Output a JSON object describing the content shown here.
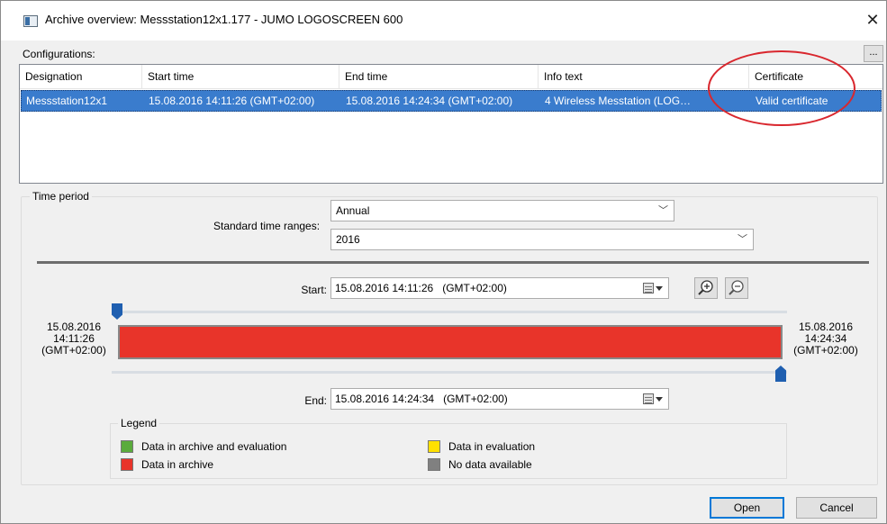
{
  "window": {
    "title": "Archive overview: Messstation12x1.177 - JUMO LOGOSCREEN 600",
    "close_glyph": "✕",
    "icon": "window-app-icon"
  },
  "configurations": {
    "label": "Configurations:",
    "more_button": "...",
    "columns": [
      "Designation",
      "Start time",
      "End time",
      "Info text",
      "Certificate"
    ],
    "rows": [
      {
        "designation": "Messstation12x1",
        "start_time": "15.08.2016 14:11:26 (GMT+02:00)",
        "end_time": "15.08.2016 14:24:34 (GMT+02:00)",
        "info_text": "4 Wireless Messtation (LOG…",
        "certificate": "Valid certificate",
        "selected": true
      }
    ],
    "highlight_color": "#d9272e"
  },
  "time_period": {
    "label": "Time period",
    "standard_ranges_label": "Standard time ranges:",
    "range_type": "Annual",
    "range_value": "2016",
    "start_label": "Start:",
    "start_value": "15.08.2016 14:11:26   (GMT+02:00)",
    "end_label": "End:",
    "end_value": "15.08.2016 14:24:34   (GMT+02:00)",
    "left_date": [
      "15.08.2016",
      "14:11:26",
      "(GMT+02:00)"
    ],
    "right_date": [
      "15.08.2016",
      "14:24:34",
      "(GMT+02:00)"
    ],
    "archive_fill_fraction": 1.0,
    "archive_color": "#e8342a"
  },
  "legend": {
    "title": "Legend",
    "items": [
      {
        "label": "Data in archive and evaluation",
        "color": "#5aab3c"
      },
      {
        "label": "Data in archive",
        "color": "#e8342a"
      },
      {
        "label": "Data in evaluation",
        "color": "#ffe000"
      },
      {
        "label": "No data available",
        "color": "#808080"
      }
    ]
  },
  "buttons": {
    "open": "Open",
    "cancel": "Cancel"
  }
}
